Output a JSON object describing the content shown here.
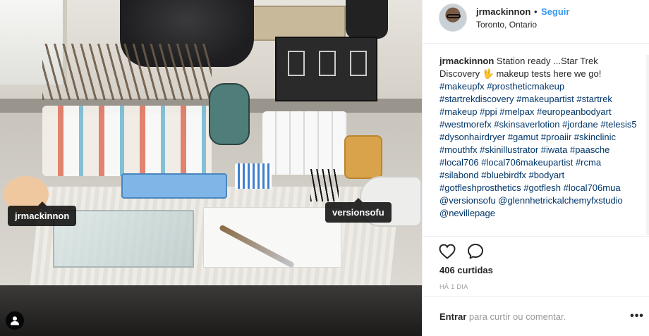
{
  "post": {
    "username": "jrmackinnon",
    "separator": "•",
    "follow_label": "Seguir",
    "location": "Toronto, Ontario"
  },
  "photo": {
    "tags": [
      "jrmackinnon",
      "versionsofu"
    ],
    "tagged_icon": "person-icon"
  },
  "caption": {
    "username": "jrmackinnon",
    "text": "Station ready ...Star Trek Discovery 🖖 makeup tests here we go!",
    "hashtags": "#makeupfx #prostheticmakeup #startrekdiscovery #makeupartist #startrek #makeup #ppi #melpax #europeanbodyart #westmorefx #skinsaverlotion #jordane #telesis5 #dysonhairdryer #gamut #proaiir #skinclinic #mouthfx #skinillustrator #iwata #paasche #local706 #local706makeupartist #rcma #silabond #bluebirdfx #bodyart #gotfleshprosthetics #gotflesh #local706mua @versionsofu @glennhetrickalchemyfxstudio @nevillepage"
  },
  "actions": {
    "like_icon": "heart-icon",
    "comment_icon": "comment-bubble-icon",
    "likes": "406 curtidas",
    "time": "HÁ 1 DIA"
  },
  "comment_bar": {
    "enter_label": "Entrar",
    "prompt": " para curtir ou comentar.",
    "more_label": "•••"
  }
}
